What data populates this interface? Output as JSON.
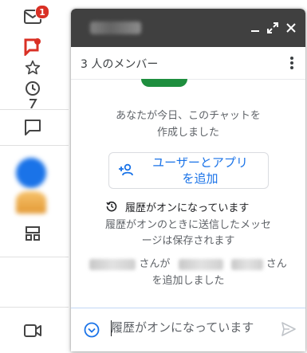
{
  "rail": {
    "mail_badge": "1",
    "icons": [
      "mail-icon",
      "chat-bubble-red-icon",
      "star-icon",
      "clock-icon",
      "chat-icon",
      "spaces-icon",
      "video-icon"
    ]
  },
  "chat": {
    "members_label": "3 人のメンバー",
    "created_text": "あなたが今日、このチャットを\n作成しました",
    "add_button_label": "ユーザーとアプリ\nを追加",
    "history_status": "履歴がオンになっています",
    "history_desc": "履歴がオンのときに送信したメッセ\nージは保存されます",
    "added_mid": "さんが",
    "added_tail": "さん",
    "added_line2": "を追加しました",
    "compose_placeholder": "履歴がオンになっています"
  },
  "colors": {
    "titlebar": "#404040",
    "accent": "#1a73e8",
    "badge": "#d93025",
    "green": "#1e8e3e"
  }
}
